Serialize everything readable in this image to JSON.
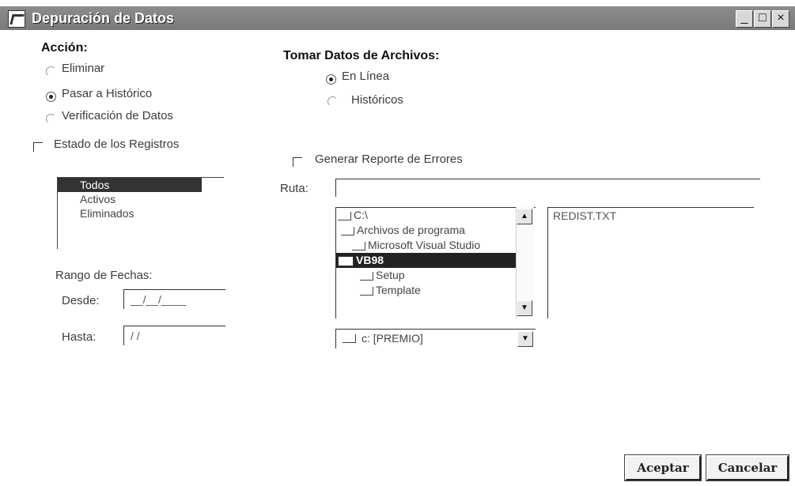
{
  "window": {
    "title": "Depuración de Datos",
    "controls": {
      "minimize": "_",
      "maximize": "□",
      "close": "×"
    }
  },
  "accion": {
    "label": "Acción:",
    "options": [
      {
        "label": "Eliminar",
        "selected": false
      },
      {
        "label": "Pasar a Histórico",
        "selected": true
      },
      {
        "label": "Verificación de Datos",
        "selected": false
      }
    ]
  },
  "tomar_datos": {
    "label": "Tomar Datos de Archivos:",
    "options": [
      {
        "label": "En Línea",
        "selected": true
      },
      {
        "label": "Históricos",
        "selected": false
      }
    ]
  },
  "estado": {
    "checkbox_label": "Estado de los Registros",
    "checked": false,
    "items": [
      {
        "label": "Todos",
        "selected": true
      },
      {
        "label": "Activos",
        "selected": false
      },
      {
        "label": "Eliminados",
        "selected": false
      }
    ]
  },
  "rango": {
    "label": "Rango de Fechas:",
    "desde_label": "Desde:",
    "desde_value": "__/__/____",
    "hasta_label": "Hasta:",
    "hasta_value": "/ /"
  },
  "reporte": {
    "checkbox_label": "Generar Reporte de Errores",
    "checked": false,
    "ruta_label": "Ruta:",
    "ruta_value": ""
  },
  "dir_list": {
    "items": [
      {
        "label": "C:\\",
        "indent": 0,
        "selected": false
      },
      {
        "label": "Archivos de programa",
        "indent": 1,
        "selected": false
      },
      {
        "label": "Microsoft Visual Studio",
        "indent": 2,
        "selected": false
      },
      {
        "label": "VB98",
        "indent": 0,
        "selected": true
      },
      {
        "label": "Setup",
        "indent": 1,
        "selected": false
      },
      {
        "label": "Template",
        "indent": 1,
        "selected": false
      }
    ]
  },
  "file_list": {
    "items": [
      "REDIST.TXT"
    ]
  },
  "drive": {
    "value": "c: [PREMIO]"
  },
  "buttons": {
    "aceptar": "Aceptar",
    "cancelar": "Cancelar"
  }
}
